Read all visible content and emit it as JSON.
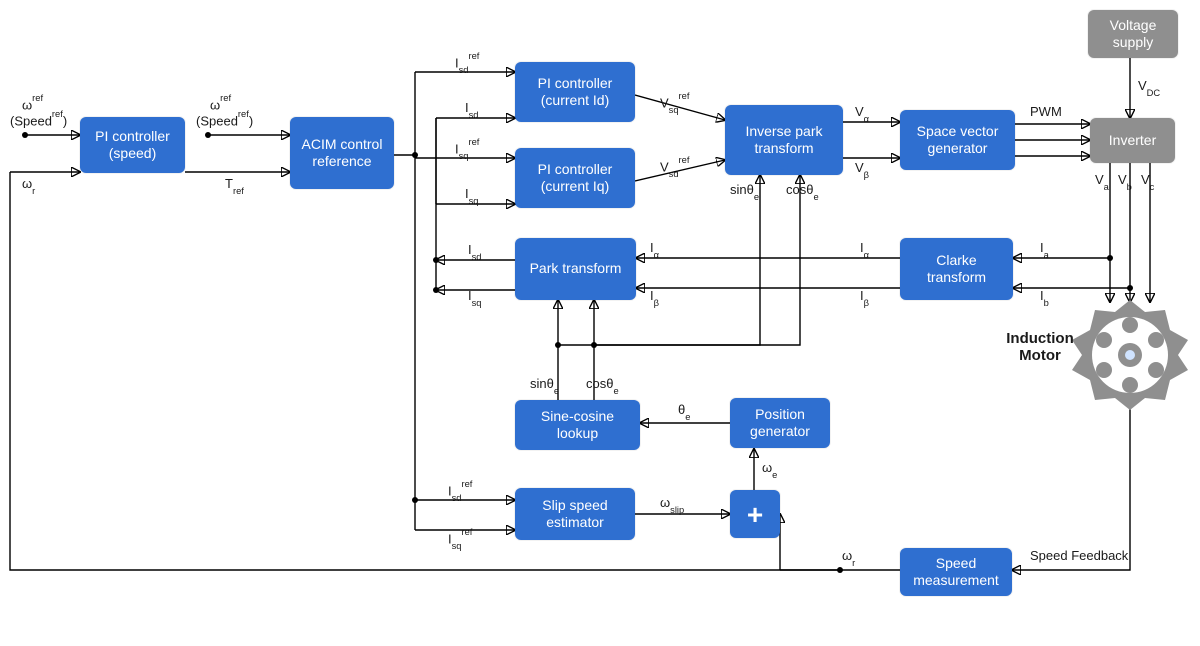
{
  "blocks": {
    "pi_speed": "PI controller (speed)",
    "acim": "ACIM control reference",
    "pi_id": "PI controller (current Id)",
    "pi_iq": "PI controller (current Iq)",
    "inv_park": "Inverse park transform",
    "svg": "Space vector generator",
    "inverter": "Inverter",
    "volt_supply": "Voltage supply",
    "park": "Park transform",
    "clarke": "Clarke transform",
    "sincos": "Sine-cosine lookup",
    "posgen": "Position generator",
    "slip": "Slip speed estimator",
    "sum": "+",
    "speed_meas": "Speed measurement"
  },
  "signals": {
    "w_ref": "ω<sup>ref</sup>",
    "speed_ref_in": "(Speed<sup>ref</sup>)",
    "wr": "ω<sub>r</sub>",
    "w_ref2": "ω<sup>ref</sup>",
    "speed_ref2": "(Speed<sup>ref</sup>)",
    "tref": "T<sub>ref</sub>",
    "isd_ref": "I<sub>sd</sub><sup>ref</sup>",
    "isq_ref": "I<sub>sq</sub><sup>ref</sup>",
    "isd": "I<sub>sd</sub>",
    "isq": "I<sub>sq</sub>",
    "vsq_ref": "V<sub>sq</sub><sup>ref</sup>",
    "vsd_ref": "V<sub>sd</sub><sup>ref</sup>",
    "valpha": "V<sub>α</sub>",
    "vbeta": "V<sub>β</sub>",
    "pwm": "PWM",
    "vdc": "V<sub>DC</sub>",
    "va": "V<sub>a</sub>",
    "vb": "V<sub>b</sub>",
    "vc": "V<sub>c</sub>",
    "ialpha": "I<sub>α</sub>",
    "ibeta": "I<sub>β</sub>",
    "ia": "I<sub>a</sub>",
    "ib": "I<sub>b</sub>",
    "sin_e": "sinθ<sub>e</sub>",
    "cos_e": "cosθ<sub>e</sub>",
    "theta_e": "θ<sub>e</sub>",
    "we": "ω<sub>e</sub>",
    "wslip": "ω<sub>slip</sub>",
    "speed_fb": "Speed Feedback"
  },
  "motor_label": "Induction Motor"
}
